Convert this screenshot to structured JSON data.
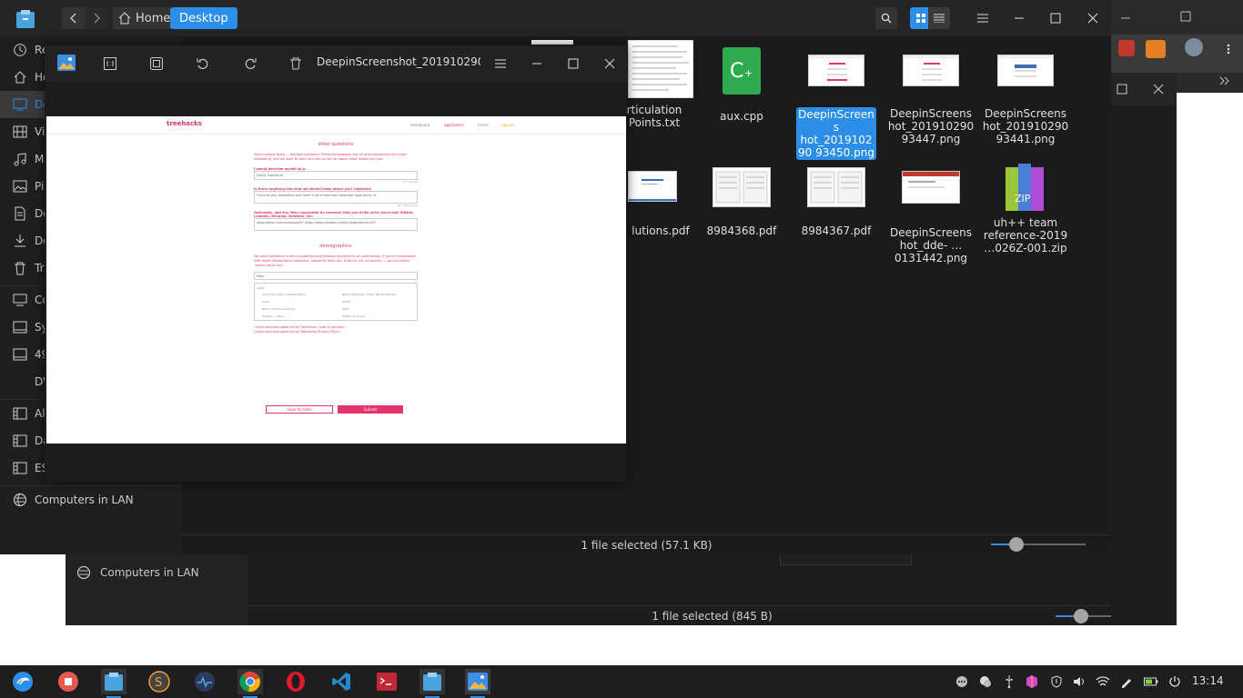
{
  "back_window": {
    "lan_label": "Computers in LAN",
    "status": "1 file selected (845 B)"
  },
  "window": {
    "breadcrumb_home": "Home",
    "breadcrumb_current": "Desktop",
    "status": "1 file selected (57.1 KB)"
  },
  "sidebar": {
    "items": [
      {
        "label": "Re",
        "icon": "recent-icon"
      },
      {
        "label": "Ho",
        "icon": "home-icon"
      },
      {
        "label": "De",
        "icon": "desktop-icon"
      },
      {
        "label": "Vi",
        "icon": "video-icon"
      },
      {
        "label": "Mu",
        "icon": "music-icon"
      },
      {
        "label": "Pic",
        "icon": "picture-icon"
      },
      {
        "label": "Do",
        "icon": "document-icon"
      },
      {
        "label": "Do",
        "icon": "download-icon"
      },
      {
        "label": "Tra",
        "icon": "trash-icon"
      },
      {
        "label": "Co",
        "icon": "computer-icon"
      },
      {
        "label": "Sy",
        "icon": "disk-icon"
      },
      {
        "label": "49",
        "icon": "disk-icon"
      },
      {
        "label": "DV",
        "icon": "dvd-icon"
      },
      {
        "label": "Alg",
        "icon": "bookmark-icon"
      },
      {
        "label": "Da",
        "icon": "bookmark-icon"
      },
      {
        "label": "ES",
        "icon": "bookmark-icon"
      }
    ],
    "lan_label": "Computers in LAN"
  },
  "files": [
    {
      "name": "rticulation Points.txt",
      "kind": "text-doc"
    },
    {
      "name": "aux.cpp",
      "kind": "cpp"
    },
    {
      "name": "DeepinScreenshot_20191029093450.png",
      "kind": "screenshot",
      "selected": true
    },
    {
      "name": "DeepinScreenshot_20191029093447.png",
      "kind": "screenshot"
    },
    {
      "name": "DeepinScreenshot_20191029093441.png",
      "kind": "screenshot"
    },
    {
      "name": "lutions.pdf",
      "kind": "pdf"
    },
    {
      "name": "8984368.pdf",
      "kind": "pdf"
    },
    {
      "name": "8984367.pdf",
      "kind": "pdf"
    },
    {
      "name": "DeepinScreenshot_dde-…0131442.png",
      "kind": "screenshot"
    },
    {
      "name": "uh++ team reference-2019…026Z-001.zip",
      "kind": "zip"
    }
  ],
  "file_labels": {
    "f0": "rticulation Points.txt",
    "f1": "aux.cpp",
    "f2": "DeepinScreens hot_201910290 93450.png",
    "f3": "DeepinScreens hot_201910290 93447.png",
    "f4": "DeepinScreens hot_201910290 93441.png",
    "f5": "lutions.pdf",
    "f6": "8984368.pdf",
    "f7": "8984367.pdf",
    "f8": "DeepinScreens hot_dde- …0131442.png",
    "f9": "uh++ team reference-2019 …026Z-001.zip"
  },
  "viewer": {
    "title": "DeepinScreenshot_2019102909",
    "page": {
      "logo": "treehacks",
      "nav": [
        "dashboard",
        "application",
        "travel",
        "log out"
      ],
      "section1": "other questions",
      "intro": "You're almost there — last few questions! These are optional, but all of our applicants are super interesting, and we want to learn as much as we can about what makes you you!",
      "q1": "I would describe myself as a...",
      "a1": "Exotic individual",
      "c1": "2 / 5 words",
      "q2": "Is there anything else that we should know about you? (optional)",
      "a2": "I love to play basketball and learn a lot of new fast computer algorithms :D",
      "c2": "15 / 100 words",
      "q3": "Optionally, add any links (separated by commas) that you'd like us to check out! GitHub, LinkedIn, Devpost, Dribbble, etc.",
      "a3": "www.github.com/ananbose97  https://www.linkedin.com/in/anglewicz/hrz97",
      "section2": "demographics",
      "demo_intro": "We want TreeHacks to be a supportive and welcoming event for all participants. If you're comfortable with these demographic questions, please fill them out. If you're not, no worries — you can select \"prefer not to say\".",
      "select": "Male",
      "race_label": "RACE",
      "race": [
        "American Indian / Alaska Native",
        "Native Hawaiian / Other Pacific Islander",
        "Asian",
        "White",
        "Black / African American",
        "Other",
        "Hispanic / Latino",
        "Prefer not to say"
      ],
      "agree1": "I have read and agree to the TreeHacks Code of Conduct.",
      "agree2": "I have read and agree to the TreeHacks Privacy Policy.",
      "save": "Save for later",
      "submit": "Submit"
    }
  },
  "taskbar": {
    "clock": "13:14"
  },
  "colors": {
    "accent": "#2b8ee8",
    "treehacks": "#e5336b"
  }
}
